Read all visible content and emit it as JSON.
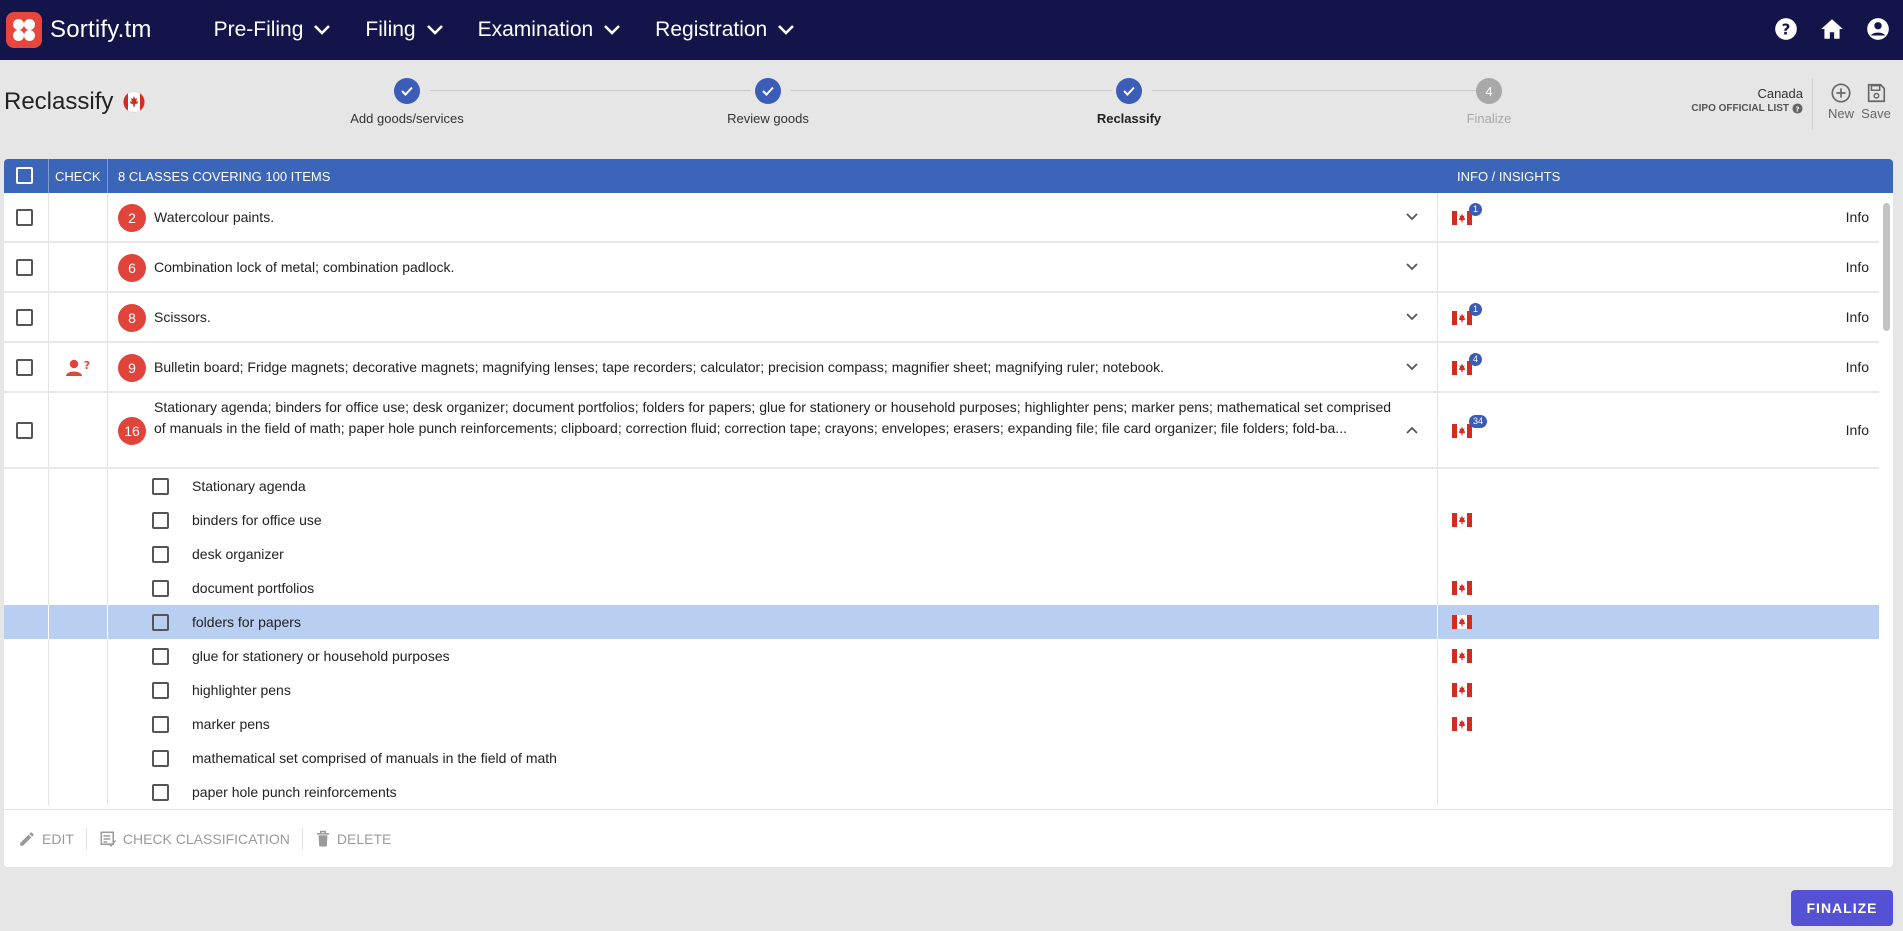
{
  "app": {
    "name": "Sortify.tm"
  },
  "nav": [
    {
      "label": "Pre-Filing"
    },
    {
      "label": "Filing"
    },
    {
      "label": "Examination"
    },
    {
      "label": "Registration"
    }
  ],
  "top_icons": [
    "help-icon",
    "home-icon",
    "account-icon"
  ],
  "page": {
    "title": "Reclassify"
  },
  "stepper": [
    {
      "label": "Add goods/services",
      "state": "done"
    },
    {
      "label": "Review goods",
      "state": "done"
    },
    {
      "label": "Reclassify",
      "state": "active"
    },
    {
      "label": "Finalize",
      "state": "todo",
      "number": "4"
    }
  ],
  "country": {
    "name": "Canada",
    "list": "CIPO OFFICIAL LIST"
  },
  "actions": {
    "new_label": "New",
    "save_label": "Save"
  },
  "table": {
    "headers": {
      "check": "CHECK",
      "classes": "8 CLASSES COVERING 100 ITEMS",
      "info": "INFO / INSIGHTS"
    },
    "classes": [
      {
        "number": "2",
        "text": "Watercolour paints.",
        "flag_count": "1",
        "info": "Info"
      },
      {
        "number": "6",
        "text": "Combination lock of metal; combination padlock.",
        "flag_count": "",
        "info": "Info"
      },
      {
        "number": "8",
        "text": "Scissors.",
        "flag_count": "1",
        "info": "Info"
      },
      {
        "number": "9",
        "text": "Bulletin board; Fridge magnets; decorative magnets; magnifying lenses; tape recorders; calculator; precision compass; magnifier sheet; magnifying ruler; notebook.",
        "flag_count": "4",
        "info": "Info"
      },
      {
        "number": "16",
        "text": "Stationary agenda; binders for office use; desk organizer; document portfolios; folders for papers; glue for stationery or household purposes; highlighter pens; marker pens; mathematical set comprised of manuals in the field of math; paper hole punch reinforcements; clipboard; correction fluid; correction tape; crayons; envelopes; erasers; expanding file; file card organizer; file folders; fold-ba...",
        "flag_count": "34",
        "info": "Info"
      }
    ],
    "sub_items": [
      {
        "text": "Stationary agenda",
        "flag": false
      },
      {
        "text": "binders for office use",
        "flag": true
      },
      {
        "text": "desk organizer",
        "flag": false
      },
      {
        "text": "document portfolios",
        "flag": true
      },
      {
        "text": "folders for papers",
        "flag": true
      },
      {
        "text": "glue for stationery or household purposes",
        "flag": true
      },
      {
        "text": "highlighter pens",
        "flag": true
      },
      {
        "text": "marker pens",
        "flag": true
      },
      {
        "text": "mathematical set comprised of manuals in the field of math",
        "flag": false
      },
      {
        "text": "paper hole punch reinforcements",
        "flag": false
      }
    ]
  },
  "footer_actions": {
    "edit": "EDIT",
    "check": "CHECK CLASSIFICATION",
    "delete": "DELETE"
  },
  "finalize": {
    "label": "FINALIZE"
  },
  "colors": {
    "nav_bg": "#13154a",
    "header_blue": "#3a65b8",
    "badge_red": "#e0443a",
    "selected_row": "#b9cff1",
    "finalize": "#5551d4"
  }
}
